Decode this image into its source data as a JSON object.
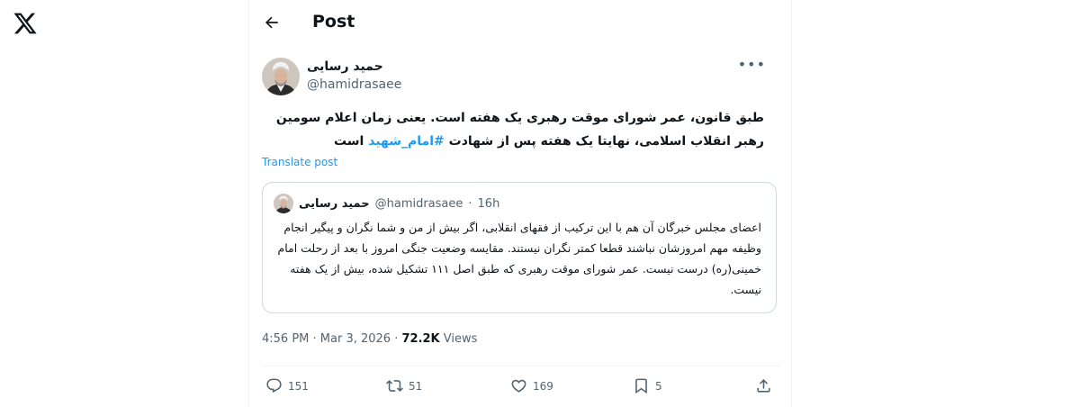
{
  "app": {
    "logo_icon": "x-logo-icon"
  },
  "header": {
    "title": "Post",
    "back_icon": "arrow-left-icon"
  },
  "post": {
    "author_name": "حمید رسایی",
    "author_handle": "@hamidrasaee",
    "text_before_hashtag": "طبق قانون، عمر شورای موقت رهبری یک هفته است. یعنی زمان اعلام سومین رهبر انقلاب اسلامی، نهایتا یک هفته پس از شهادت ",
    "hashtag": "#امام_شهید",
    "text_after_hashtag": " است",
    "translate_label": "Translate post",
    "time": "4:56 PM",
    "date": "Mar 3, 2026",
    "views_count": "72.2K",
    "views_label": "Views"
  },
  "quote": {
    "author_name": "حمید رسایی",
    "author_handle": "@hamidrasaee",
    "age": "16h",
    "text": "اعضای مجلس خبرگان آن هم با این ترکیب از فقهای انقلابی، اگر بیش از من و شما نگران و پیگیر انجام وظیفه مهم امروزشان نباشند قطعا کمتر نگران نیستند. مقایسه وضعیت جنگی امروز با بعد از رحلت امام خمینی(ره) درست نیست. عمر شورای موقت رهبری که طبق اصل ۱۱۱ تشکیل شده، بیش از یک هفته نیست."
  },
  "actions": {
    "replies": "151",
    "reposts": "51",
    "likes": "169",
    "bookmarks": "5"
  },
  "colors": {
    "accent": "#1d9bf0",
    "text": "#0f1419",
    "secondary": "#536471",
    "border": "#cfd9de"
  }
}
